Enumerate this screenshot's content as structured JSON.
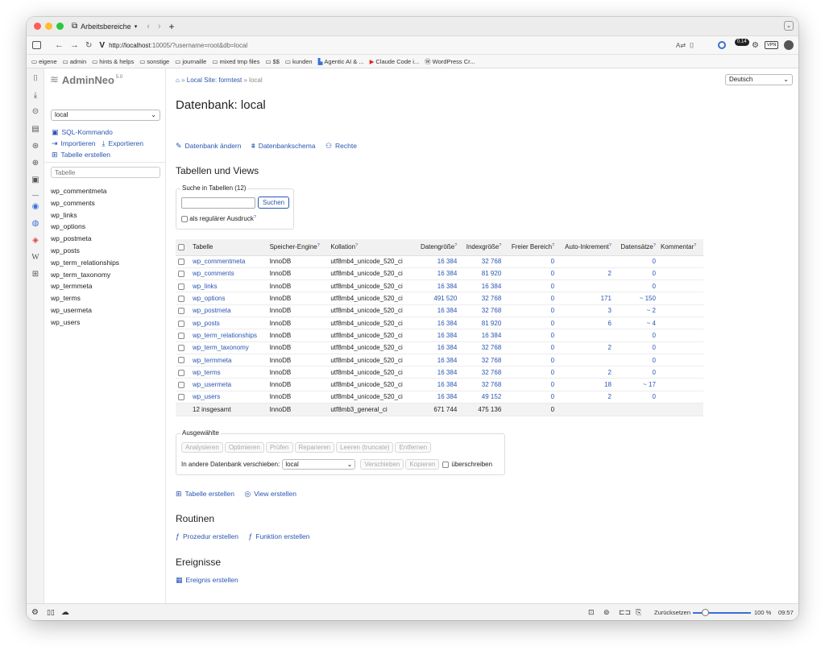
{
  "browser": {
    "workspace_label": "Arbeitsbereiche",
    "url_host": "http://localhost",
    "url_rest": ":10005/?username=root&db=local",
    "shield_badge": "0.14",
    "vpn_label": "VPN",
    "bookmarks": [
      "eigene",
      "admin",
      "hints & helps",
      "sonstige",
      "journaille",
      "mixed tmp files",
      "$$",
      "kunden",
      "Agentic AI & ...",
      "Claude Code i...",
      "WordPress Cr..."
    ]
  },
  "app": {
    "logo_text": "AdminNeo",
    "version": "5.0",
    "db_select": "local",
    "sidebar_actions": {
      "sql": "SQL-Kommando",
      "import": "Importieren",
      "export": "Exportieren",
      "create_table": "Tabelle erstellen"
    },
    "table_filter_placeholder": "Tabelle",
    "tables": [
      "wp_commentmeta",
      "wp_comments",
      "wp_links",
      "wp_options",
      "wp_postmeta",
      "wp_posts",
      "wp_term_relationships",
      "wp_term_taxonomy",
      "wp_termmeta",
      "wp_terms",
      "wp_usermeta",
      "wp_users"
    ]
  },
  "main": {
    "breadcrumb": {
      "sep1": "»",
      "site": "Local Site: formtest",
      "sep2": "»",
      "db": "local"
    },
    "language": "Deutsch",
    "title": "Datenbank: local",
    "links": {
      "alter": "Datenbank ändern",
      "schema": "Datenbankschema",
      "rights": "Rechte"
    },
    "section_tables": "Tabellen und Views",
    "search": {
      "legend": "Suche in Tabellen (12)",
      "button": "Suchen",
      "regex_label": "als regulärer Ausdruck"
    },
    "columns": [
      "Tabelle",
      "Speicher-Engine",
      "Kollation",
      "Datengröße",
      "Indexgröße",
      "Freier Bereich",
      "Auto-Inkrement",
      "Datensätze",
      "Kommentar"
    ],
    "rows": [
      [
        "wp_commentmeta",
        "InnoDB",
        "utf8mb4_unicode_520_ci",
        "16 384",
        "32 768",
        "0",
        "",
        "0"
      ],
      [
        "wp_comments",
        "InnoDB",
        "utf8mb4_unicode_520_ci",
        "16 384",
        "81 920",
        "0",
        "2",
        "0"
      ],
      [
        "wp_links",
        "InnoDB",
        "utf8mb4_unicode_520_ci",
        "16 384",
        "16 384",
        "0",
        "",
        "0"
      ],
      [
        "wp_options",
        "InnoDB",
        "utf8mb4_unicode_520_ci",
        "491 520",
        "32 768",
        "0",
        "171",
        "~ 150"
      ],
      [
        "wp_postmeta",
        "InnoDB",
        "utf8mb4_unicode_520_ci",
        "16 384",
        "32 768",
        "0",
        "3",
        "~ 2"
      ],
      [
        "wp_posts",
        "InnoDB",
        "utf8mb4_unicode_520_ci",
        "16 384",
        "81 920",
        "0",
        "6",
        "~ 4"
      ],
      [
        "wp_term_relationships",
        "InnoDB",
        "utf8mb4_unicode_520_ci",
        "16 384",
        "16 384",
        "0",
        "",
        "0"
      ],
      [
        "wp_term_taxonomy",
        "InnoDB",
        "utf8mb4_unicode_520_ci",
        "16 384",
        "32 768",
        "0",
        "2",
        "0"
      ],
      [
        "wp_termmeta",
        "InnoDB",
        "utf8mb4_unicode_520_ci",
        "16 384",
        "32 768",
        "0",
        "",
        "0"
      ],
      [
        "wp_terms",
        "InnoDB",
        "utf8mb4_unicode_520_ci",
        "16 384",
        "32 768",
        "0",
        "2",
        "0"
      ],
      [
        "wp_usermeta",
        "InnoDB",
        "utf8mb4_unicode_520_ci",
        "16 384",
        "32 768",
        "0",
        "18",
        "~ 17"
      ],
      [
        "wp_users",
        "InnoDB",
        "utf8mb4_unicode_520_ci",
        "16 384",
        "49 152",
        "0",
        "2",
        "0"
      ]
    ],
    "footer_row": {
      "name": "12 insgesamt",
      "engine": "InnoDB",
      "collation": "utf8mb3_general_ci",
      "data": "671 744",
      "index": "475 136",
      "free": "0"
    },
    "selected": {
      "legend": "Ausgewählte",
      "buttons": [
        "Analysieren",
        "Optimieren",
        "Prüfen",
        "Reparieren",
        "Leeren (truncate)",
        "Entfernen"
      ],
      "move_label": "In andere Datenbank verschieben:",
      "move_target": "local",
      "move_button": "Verschieben",
      "copy_button": "Kopieren",
      "overwrite_label": "überschreiben"
    },
    "create_links": {
      "table": "Tabelle erstellen",
      "view": "View erstellen"
    },
    "section_routines": "Routinen",
    "routine_links": {
      "procedure": "Prozedur erstellen",
      "function": "Funktion erstellen"
    },
    "section_events": "Ereignisse",
    "event_link": "Ereignis erstellen"
  },
  "status": {
    "reset": "Zurücksetzen",
    "zoom": "100 %",
    "time": "09:57"
  },
  "colors": {
    "link": "#2a55b3",
    "red": "#ff5f57",
    "yellow": "#febc2e",
    "green": "#28c840"
  }
}
